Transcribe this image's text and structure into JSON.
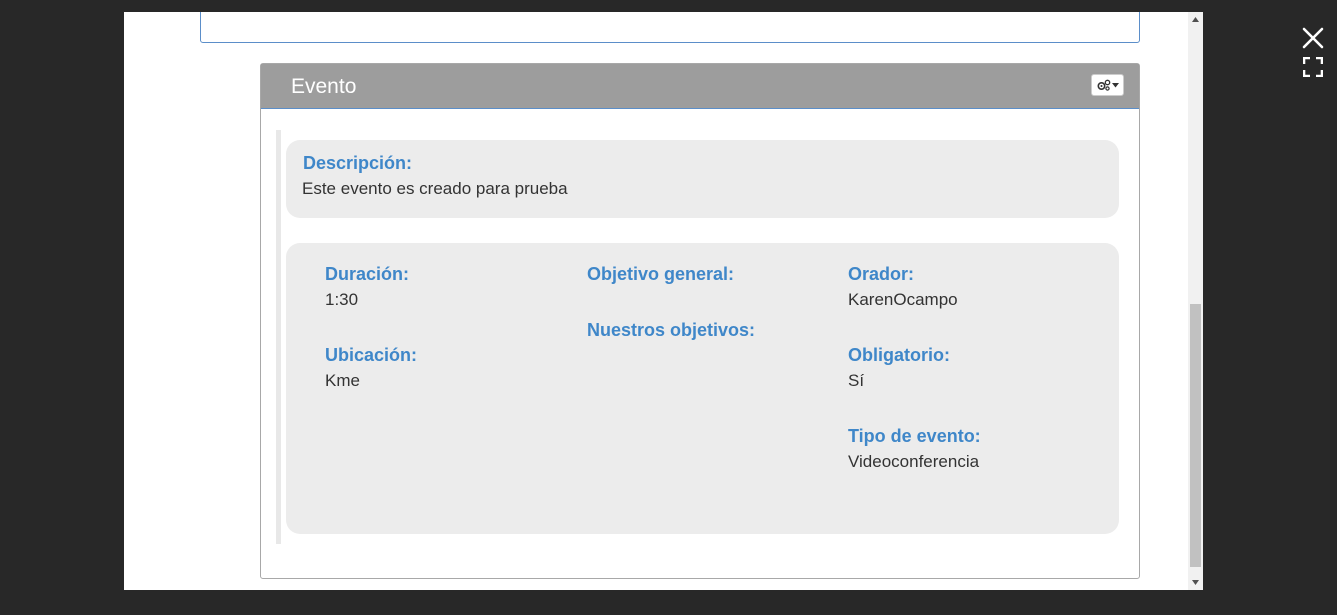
{
  "viewer": {
    "close_icon": "close-icon",
    "fullscreen_icon": "fullscreen-icon"
  },
  "panel": {
    "title": "Evento",
    "settings_icon": "gears-icon",
    "dropdown_icon": "caret-down-icon"
  },
  "description": {
    "label": "Descripción:",
    "value": "Este evento es creado para prueba"
  },
  "details": {
    "duration": {
      "label": "Duración:",
      "value": "1:30"
    },
    "location": {
      "label": "Ubicación:",
      "value": "Kme"
    },
    "general_objective": {
      "label": "Objetivo general:",
      "value": ""
    },
    "our_objectives": {
      "label": "Nuestros objetivos:",
      "value": ""
    },
    "speaker": {
      "label": "Orador:",
      "value": "KarenOcampo"
    },
    "mandatory": {
      "label": "Obligatorio:",
      "value": "Sí"
    },
    "event_type": {
      "label": "Tipo de evento:",
      "value": "Videoconferencia"
    }
  },
  "colors": {
    "label_blue": "#3f87c9",
    "header_gray": "#9d9d9d",
    "card_gray": "#ececec",
    "accent_green": "#4caf50"
  }
}
